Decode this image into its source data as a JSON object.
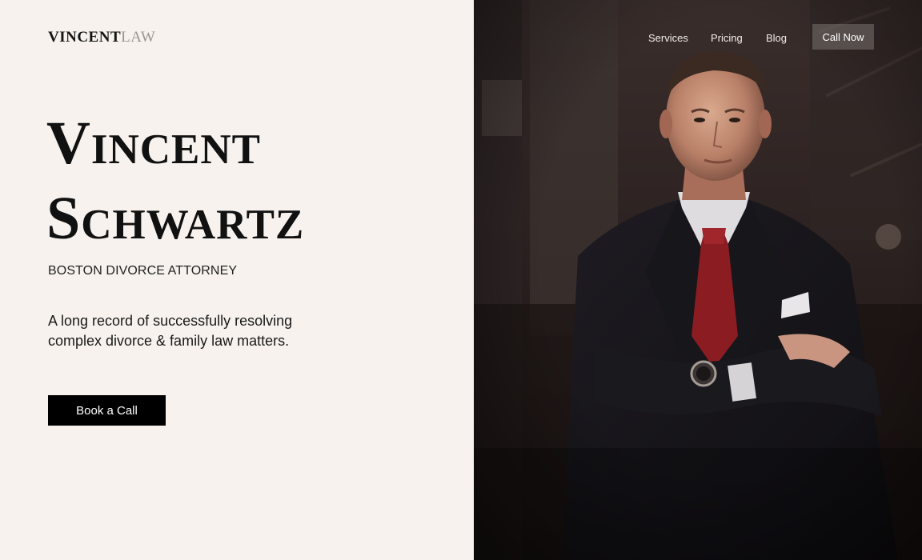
{
  "brand": {
    "logo_strong": "VINCENT",
    "logo_light": "LAW"
  },
  "nav": {
    "links": [
      "Services",
      "Pricing",
      "Blog"
    ],
    "cta_label": "Call Now"
  },
  "hero": {
    "title_line1": "Vincent",
    "title_line2": "Schwartz",
    "subtitle": "BOSTON DIVORCE ATTORNEY",
    "description": "A long record of successfully resolving complex divorce & family law matters.",
    "button_label": "Book a Call"
  },
  "photo": {
    "subject": "attorney-portrait"
  },
  "colors": {
    "background": "#f7f2ed",
    "text": "#111111",
    "button": "#000000",
    "tie": "#8b1c22",
    "suit": "#141318"
  }
}
